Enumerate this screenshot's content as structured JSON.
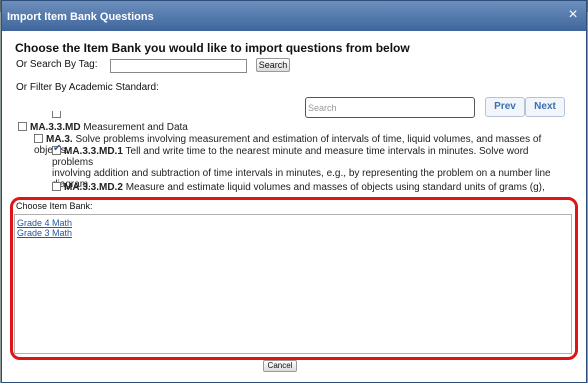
{
  "dialog": {
    "title": "Import Item Bank Questions",
    "close_icon": "×",
    "heading": "Choose the Item Bank you would like to import questions from below",
    "tag_label": "Or Search By Tag:",
    "tag_value": "",
    "search_button": "Search",
    "filter_label": "Or Filter By Academic Standard:",
    "standard_search_placeholder": "Search",
    "prev_button": "Prev",
    "next_button": "Next",
    "cancel_button": "Cancel"
  },
  "standards": [
    {
      "code": "MA.3.3.MD",
      "text": "Measurement and Data",
      "checked": false
    },
    {
      "code": "MA.3.",
      "text": "Solve problems involving measurement and estimation of intervals of time, liquid volumes, and masses of objects.",
      "checked": false
    },
    {
      "code": "MA.3.3.MD.1",
      "text": "Tell and write time to the nearest minute and measure time intervals in minutes. Solve word problems",
      "text2": "involving addition and subtraction of time intervals in minutes, e.g., by representing the problem on a number line",
      "text3": "diagram.",
      "checked": true
    },
    {
      "code": "MA.3.3.MD.2",
      "text": "Measure and estimate liquid volumes and masses of objects using standard units of grams (g),",
      "checked": false
    }
  ],
  "item_bank": {
    "label": "Choose Item Bank:",
    "items": [
      "Grade 4 Math",
      "Grade 3 Math"
    ]
  },
  "colors": {
    "title_bar": "#3f669c",
    "link": "#2556a8",
    "highlight": "#dd1515"
  }
}
